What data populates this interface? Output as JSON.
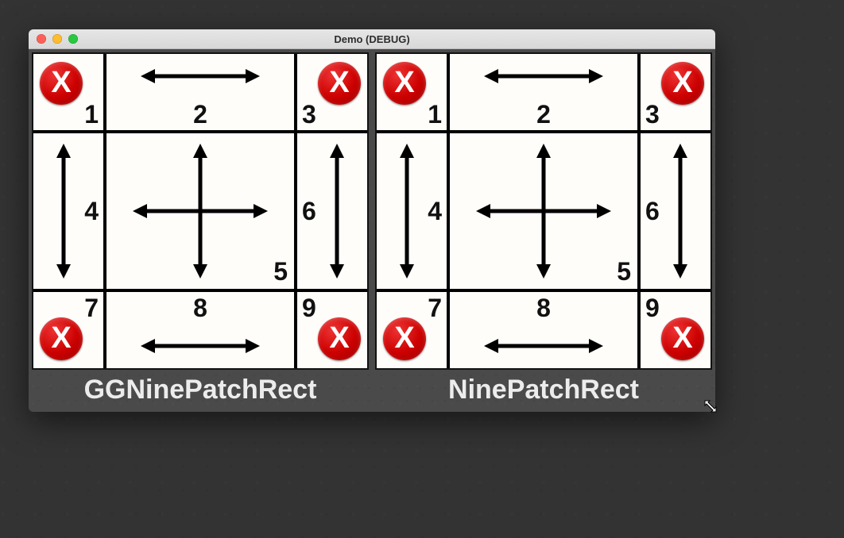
{
  "window": {
    "title": "Demo (DEBUG)"
  },
  "traffic_lights": {
    "close": "close",
    "minimize": "minimize",
    "zoom": "zoom"
  },
  "panels": [
    {
      "label": "GGNinePatchRect"
    },
    {
      "label": "NinePatchRect"
    }
  ],
  "ninepatch": {
    "region_1": "1",
    "region_2": "2",
    "region_3": "3",
    "region_4": "4",
    "region_5": "5",
    "region_6": "6",
    "region_7": "7",
    "region_8": "8",
    "region_9": "9",
    "corner_glyph": "X"
  },
  "colors": {
    "desktop_bg": "#333333",
    "window_body": "#4a4a4a",
    "titlebar_top": "#e6e6e6",
    "titlebar_bottom": "#d8d8d8",
    "panel_bg": "#fffdfa",
    "grid_line": "#000000",
    "label_text": "#ececec",
    "corner_red": "#c00000"
  },
  "cursor": {
    "name": "resize-nwse"
  }
}
